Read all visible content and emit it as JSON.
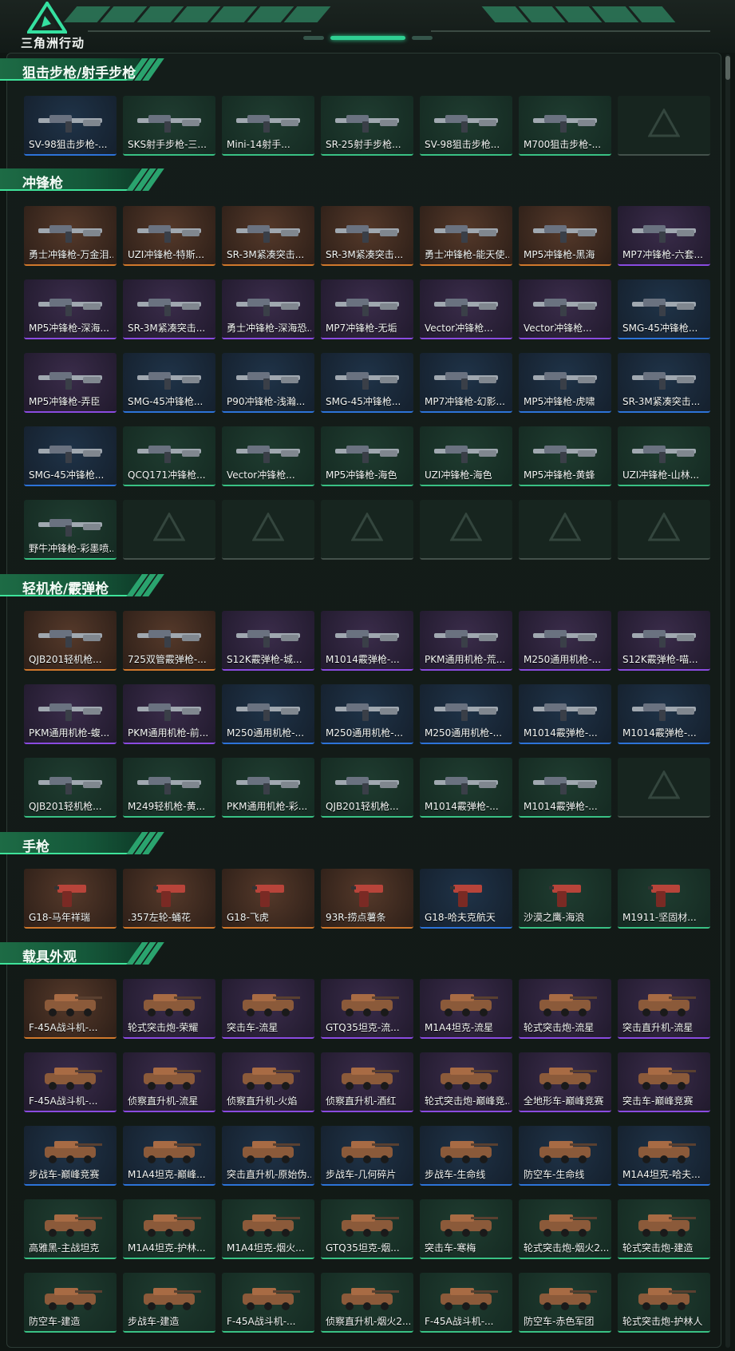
{
  "app": {
    "brand": "三角洲行动"
  },
  "colors": {
    "gold": "#d0782c",
    "purple": "#8a4be0",
    "blue": "#2d73d8",
    "green": "#39c184",
    "accent": "#2fcf92"
  },
  "sections": [
    {
      "title": "狙击步枪/射手步枪",
      "items": [
        {
          "name": "SV-98狙击步枪-...",
          "rarity": "blue"
        },
        {
          "name": "SKS射手步枪-三...",
          "rarity": "green"
        },
        {
          "name": "Mini-14射手...",
          "rarity": "green"
        },
        {
          "name": "SR-25射手步枪...",
          "rarity": "green"
        },
        {
          "name": "SV-98狙击步枪...",
          "rarity": "green"
        },
        {
          "name": "M700狙击步枪-...",
          "rarity": "green"
        },
        {
          "name": "",
          "rarity": "empty"
        }
      ]
    },
    {
      "title": "冲锋枪",
      "items": [
        {
          "name": "勇士冲锋枪-万金泪...",
          "rarity": "gold"
        },
        {
          "name": "UZI冲锋枪-特斯...",
          "rarity": "gold"
        },
        {
          "name": "SR-3M紧凑突击...",
          "rarity": "gold"
        },
        {
          "name": "SR-3M紧凑突击...",
          "rarity": "gold"
        },
        {
          "name": "勇士冲锋枪-能天使...",
          "rarity": "gold"
        },
        {
          "name": "MP5冲锋枪-黑海",
          "rarity": "gold"
        },
        {
          "name": "MP7冲锋枪-六套...",
          "rarity": "purple"
        },
        {
          "name": "MP5冲锋枪-深海...",
          "rarity": "purple"
        },
        {
          "name": "SR-3M紧凑突击...",
          "rarity": "purple"
        },
        {
          "name": "勇士冲锋枪-深海恐...",
          "rarity": "purple"
        },
        {
          "name": "MP7冲锋枪-无垢",
          "rarity": "purple"
        },
        {
          "name": "Vector冲锋枪...",
          "rarity": "purple"
        },
        {
          "name": "Vector冲锋枪...",
          "rarity": "purple"
        },
        {
          "name": "SMG-45冲锋枪...",
          "rarity": "blue"
        },
        {
          "name": "MP5冲锋枪-弄臣",
          "rarity": "purple"
        },
        {
          "name": "SMG-45冲锋枪...",
          "rarity": "blue"
        },
        {
          "name": "P90冲锋枪-浅瀚...",
          "rarity": "blue"
        },
        {
          "name": "SMG-45冲锋枪...",
          "rarity": "blue"
        },
        {
          "name": "MP7冲锋枪-幻影...",
          "rarity": "blue"
        },
        {
          "name": "MP5冲锋枪-虎啸",
          "rarity": "blue"
        },
        {
          "name": "SR-3M紧凑突击...",
          "rarity": "blue"
        },
        {
          "name": "SMG-45冲锋枪...",
          "rarity": "blue"
        },
        {
          "name": "QCQ171冲锋枪...",
          "rarity": "green"
        },
        {
          "name": "Vector冲锋枪...",
          "rarity": "green"
        },
        {
          "name": "MP5冲锋枪-海色",
          "rarity": "green"
        },
        {
          "name": "UZI冲锋枪-海色",
          "rarity": "green"
        },
        {
          "name": "MP5冲锋枪-黄蜂",
          "rarity": "green"
        },
        {
          "name": "UZI冲锋枪-山林...",
          "rarity": "green"
        },
        {
          "name": "野牛冲锋枪-彩墨喷...",
          "rarity": "green"
        },
        {
          "name": "",
          "rarity": "empty"
        },
        {
          "name": "",
          "rarity": "empty"
        },
        {
          "name": "",
          "rarity": "empty"
        },
        {
          "name": "",
          "rarity": "empty"
        },
        {
          "name": "",
          "rarity": "empty"
        },
        {
          "name": "",
          "rarity": "empty"
        }
      ]
    },
    {
      "title": "轻机枪/霰弹枪",
      "items": [
        {
          "name": "QJB201轻机枪...",
          "rarity": "gold"
        },
        {
          "name": "725双管霰弹枪-...",
          "rarity": "gold"
        },
        {
          "name": "S12K霰弹枪-城...",
          "rarity": "purple"
        },
        {
          "name": "M1014霰弹枪-...",
          "rarity": "purple"
        },
        {
          "name": "PKM通用机枪-荒...",
          "rarity": "purple"
        },
        {
          "name": "M250通用机枪-...",
          "rarity": "purple"
        },
        {
          "name": "S12K霰弹枪-喵...",
          "rarity": "purple"
        },
        {
          "name": "PKM通用机枪-蝮...",
          "rarity": "purple"
        },
        {
          "name": "PKM通用机枪-前...",
          "rarity": "purple"
        },
        {
          "name": "M250通用机枪-...",
          "rarity": "blue"
        },
        {
          "name": "M250通用机枪-...",
          "rarity": "blue"
        },
        {
          "name": "M250通用机枪-...",
          "rarity": "blue"
        },
        {
          "name": "M1014霰弹枪-...",
          "rarity": "blue"
        },
        {
          "name": "M1014霰弹枪-...",
          "rarity": "blue"
        },
        {
          "name": "QJB201轻机枪...",
          "rarity": "green"
        },
        {
          "name": "M249轻机枪-黄...",
          "rarity": "green"
        },
        {
          "name": "PKM通用机枪-彩...",
          "rarity": "green"
        },
        {
          "name": "QJB201轻机枪...",
          "rarity": "green"
        },
        {
          "name": "M1014霰弹枪-...",
          "rarity": "green"
        },
        {
          "name": "M1014霰弹枪-...",
          "rarity": "green"
        },
        {
          "name": "",
          "rarity": "empty"
        }
      ]
    },
    {
      "title": "手枪",
      "items": [
        {
          "name": "G18-马年祥瑞",
          "rarity": "gold"
        },
        {
          "name": ".357左轮-蛹花",
          "rarity": "gold"
        },
        {
          "name": "G18-飞虎",
          "rarity": "gold"
        },
        {
          "name": "93R-捞点薯条",
          "rarity": "gold"
        },
        {
          "name": "G18-哈夫克航天",
          "rarity": "blue"
        },
        {
          "name": "沙漠之鹰-海浪",
          "rarity": "green"
        },
        {
          "name": "M1911-坚固材...",
          "rarity": "green"
        }
      ]
    },
    {
      "title": "载具外观",
      "items": [
        {
          "name": "F-45A战斗机-...",
          "rarity": "gold"
        },
        {
          "name": "轮式突击炮-荣耀",
          "rarity": "purple"
        },
        {
          "name": "突击车-流星",
          "rarity": "purple"
        },
        {
          "name": "GTQ35坦克-流...",
          "rarity": "purple"
        },
        {
          "name": "M1A4坦克-流星",
          "rarity": "purple"
        },
        {
          "name": "轮式突击炮-流星",
          "rarity": "purple"
        },
        {
          "name": "突击直升机-流星",
          "rarity": "purple"
        },
        {
          "name": "F-45A战斗机-...",
          "rarity": "purple"
        },
        {
          "name": "侦察直升机-流星",
          "rarity": "purple"
        },
        {
          "name": "侦察直升机-火焰",
          "rarity": "purple"
        },
        {
          "name": "侦察直升机-酒红",
          "rarity": "purple"
        },
        {
          "name": "轮式突击炮-巅峰竞...",
          "rarity": "purple"
        },
        {
          "name": "全地形车-巅峰竞赛",
          "rarity": "purple"
        },
        {
          "name": "突击车-巅峰竞赛",
          "rarity": "purple"
        },
        {
          "name": "步战车-巅峰竞赛",
          "rarity": "blue"
        },
        {
          "name": "M1A4坦克-巅峰...",
          "rarity": "blue"
        },
        {
          "name": "突击直升机-原始伪...",
          "rarity": "blue"
        },
        {
          "name": "步战车-几何碎片",
          "rarity": "blue"
        },
        {
          "name": "步战车-生命线",
          "rarity": "blue"
        },
        {
          "name": "防空车-生命线",
          "rarity": "blue"
        },
        {
          "name": "M1A4坦克-哈夫...",
          "rarity": "blue"
        },
        {
          "name": "高雅黑-主战坦克",
          "rarity": "green"
        },
        {
          "name": "M1A4坦克-护林...",
          "rarity": "green"
        },
        {
          "name": "M1A4坦克-烟火...",
          "rarity": "green"
        },
        {
          "name": "GTQ35坦克-烟...",
          "rarity": "green"
        },
        {
          "name": "突击车-寒梅",
          "rarity": "green"
        },
        {
          "name": "轮式突击炮-烟火2...",
          "rarity": "green"
        },
        {
          "name": "轮式突击炮-建造",
          "rarity": "green"
        },
        {
          "name": "防空车-建造",
          "rarity": "green"
        },
        {
          "name": "步战车-建造",
          "rarity": "green"
        },
        {
          "name": "F-45A战斗机-...",
          "rarity": "green"
        },
        {
          "name": "侦察直升机-烟火2...",
          "rarity": "green"
        },
        {
          "name": "F-45A战斗机-...",
          "rarity": "green"
        },
        {
          "name": "防空车-赤色军团",
          "rarity": "green"
        },
        {
          "name": "轮式突击炮-护林人",
          "rarity": "green"
        }
      ]
    }
  ]
}
